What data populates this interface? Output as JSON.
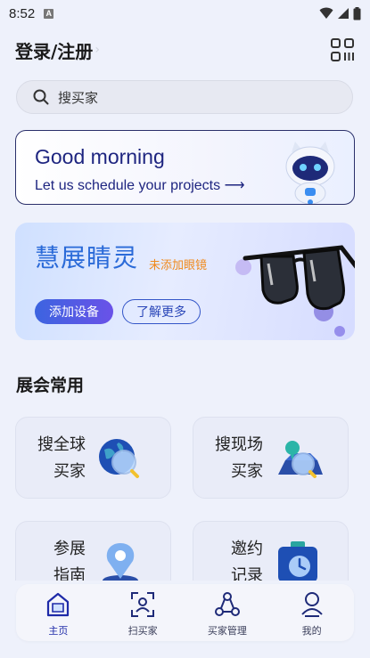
{
  "status_bar": {
    "time": "8:52",
    "notif_letter": "A"
  },
  "header": {
    "title": "登录/注册",
    "chevron": "›"
  },
  "search": {
    "placeholder": "搜买家"
  },
  "greeting": {
    "title": "Good morning",
    "subtitle": "Let us schedule your projects",
    "arrow": "⟶"
  },
  "glasses": {
    "title": "慧展睛灵",
    "subtitle": "未添加眼镜",
    "add_button": "添加设备",
    "learn_button": "了解更多"
  },
  "section": {
    "title": "展会常用"
  },
  "tiles": [
    {
      "line1": "搜全球",
      "line2": "买家",
      "icon": "globe-search-icon"
    },
    {
      "line1": "搜现场",
      "line2": "买家",
      "icon": "venue-search-icon"
    },
    {
      "line1": "参展",
      "line2": "指南",
      "icon": "map-pin-icon"
    },
    {
      "line1": "邀约",
      "line2": "记录",
      "icon": "clock-bag-icon"
    }
  ],
  "tabbar": [
    {
      "label": "主页",
      "icon": "home-icon",
      "active": true
    },
    {
      "label": "扫买家",
      "icon": "scan-icon",
      "active": false
    },
    {
      "label": "买家管理",
      "icon": "network-icon",
      "active": false
    },
    {
      "label": "我的",
      "icon": "user-icon",
      "active": false
    }
  ],
  "colors": {
    "primary": "#1e2580",
    "accent_blue": "#2a6ad8",
    "accent_orange": "#f08a1c",
    "background": "#eef1fb"
  }
}
